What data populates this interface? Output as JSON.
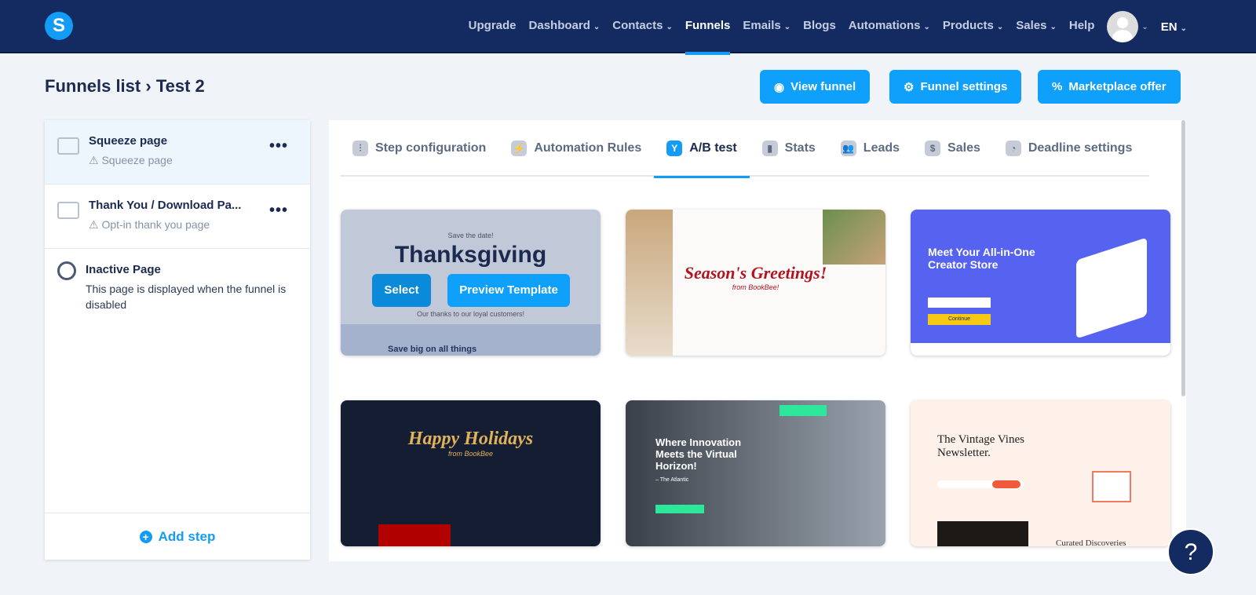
{
  "nav": {
    "items": [
      {
        "label": "Upgrade",
        "dd": false
      },
      {
        "label": "Dashboard",
        "dd": true
      },
      {
        "label": "Contacts",
        "dd": true
      },
      {
        "label": "Funnels",
        "dd": false
      },
      {
        "label": "Emails",
        "dd": true
      },
      {
        "label": "Blogs",
        "dd": false
      },
      {
        "label": "Automations",
        "dd": true
      },
      {
        "label": "Products",
        "dd": true
      },
      {
        "label": "Sales",
        "dd": true
      },
      {
        "label": "Help",
        "dd": false
      }
    ],
    "active": "Funnels",
    "lang": "EN",
    "logo": "S"
  },
  "breadcrumb": {
    "parent": "Funnels list",
    "sep": "›",
    "current": "Test 2"
  },
  "actions": {
    "view": "View funnel",
    "settings": "Funnel settings",
    "market": "Marketplace offer"
  },
  "steps": [
    {
      "title": "Squeeze page",
      "sub": "Squeeze page"
    },
    {
      "title": "Thank You / Download Pa...",
      "sub": "Opt-in thank you page"
    }
  ],
  "inactive": {
    "title": "Inactive Page",
    "desc": "This page is displayed when the funnel is disabled"
  },
  "add_step": "Add step",
  "tabs": [
    "Step configuration",
    "Automation Rules",
    "A/B test",
    "Stats",
    "Leads",
    "Sales",
    "Deadline settings"
  ],
  "active_tab": "A/B test",
  "templates": [
    {
      "title": "Thanksgiving",
      "top": "Save the date!",
      "sub": "Our thanks to our loyal customers!",
      "extra": "Save big on all things",
      "select": "Select",
      "preview": "Preview Template"
    },
    {
      "title": "Season's Greetings!",
      "sub": "from BookBee!"
    },
    {
      "title": "Meet Your All-in-One Creator Store",
      "sub": "Continue"
    },
    {
      "title": "Happy Holidays",
      "sub": "from BookBee"
    },
    {
      "title": "Where Innovation Meets the Virtual Horizon!",
      "sub": "– The Atlantic"
    },
    {
      "title": "The Vintage Vines Newsletter.",
      "sub": "Curated Discoveries"
    }
  ],
  "help": "?"
}
